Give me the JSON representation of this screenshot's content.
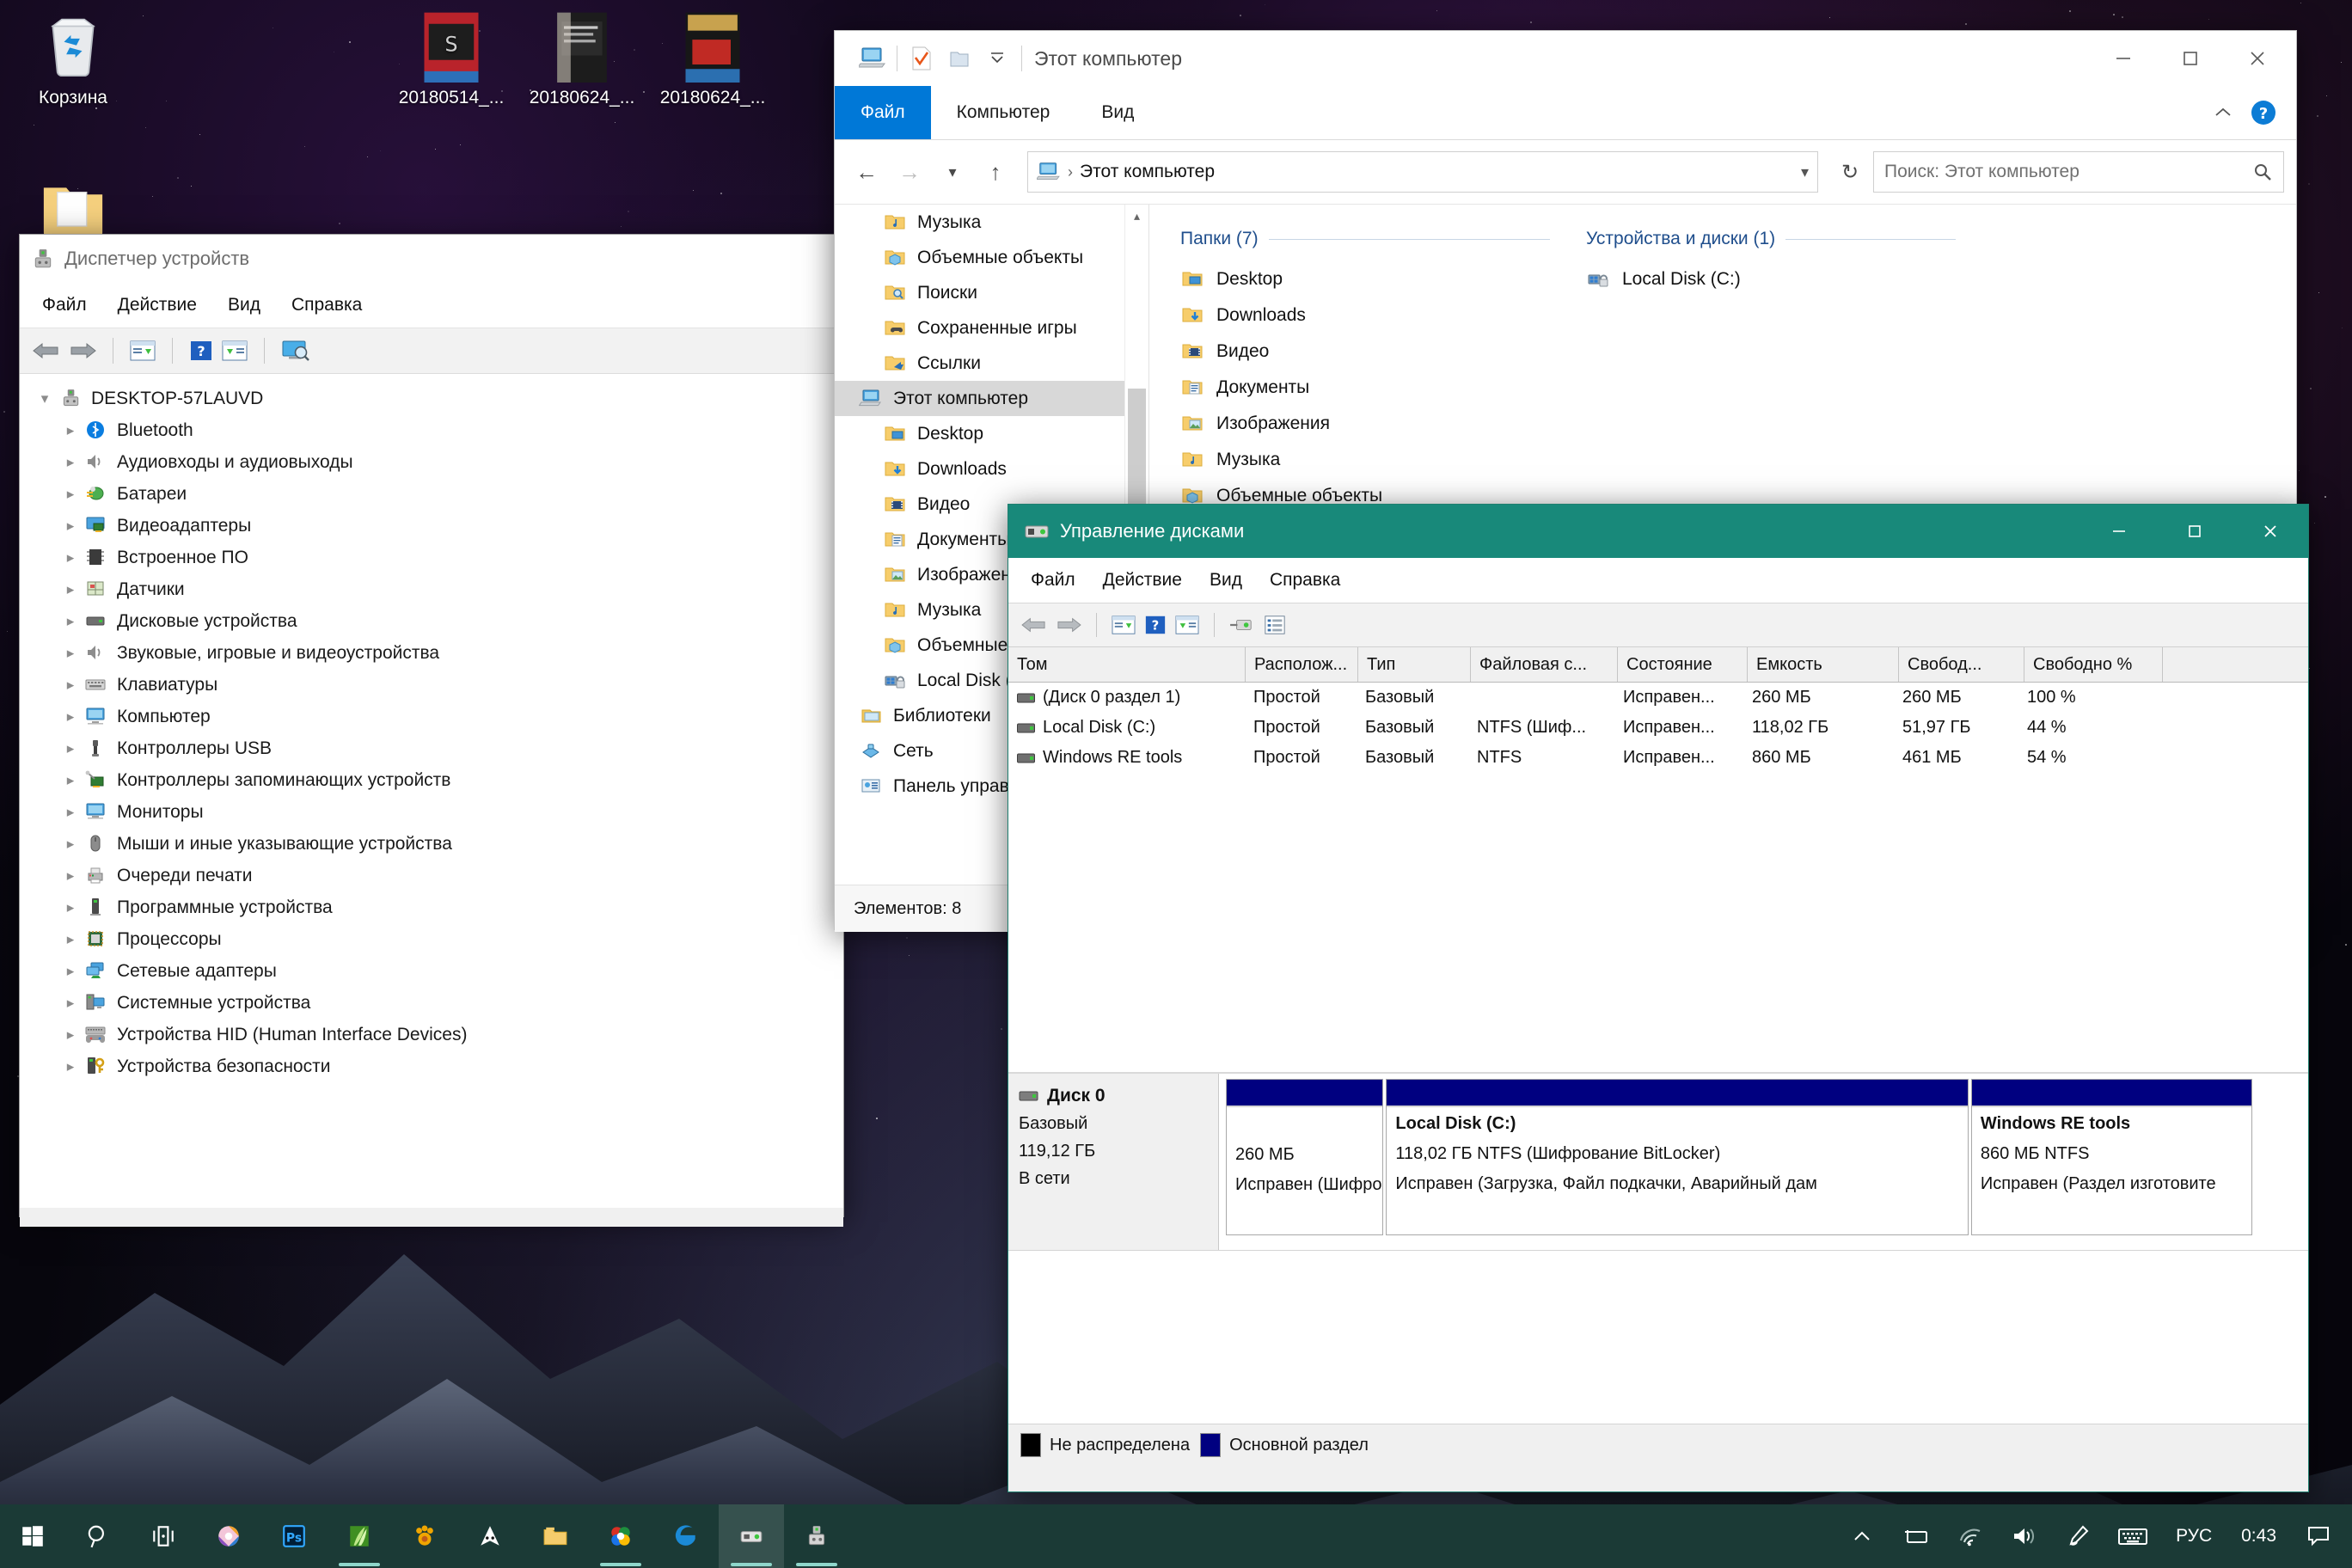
{
  "desktop": {
    "icons": [
      {
        "name": "recycle-bin",
        "label": "Корзина"
      },
      {
        "name": "photo-1",
        "label": "20180514_..."
      },
      {
        "name": "photo-2",
        "label": "20180624_..."
      },
      {
        "name": "photo-3",
        "label": "20180624_..."
      }
    ]
  },
  "device_manager": {
    "title": "Диспетчер устройств",
    "menu": [
      "Файл",
      "Действие",
      "Вид",
      "Справка"
    ],
    "toolbar_icons": [
      "back-arrow-icon",
      "forward-arrow-icon",
      "properties-icon",
      "help-icon",
      "update-driver-icon",
      "scan-hardware-icon"
    ],
    "root": "DESKTOP-57LAUVD",
    "items": [
      {
        "label": "Bluetooth",
        "icon": "bluetooth-icon"
      },
      {
        "label": "Аудиовходы и аудиовыходы",
        "icon": "audio-icon"
      },
      {
        "label": "Батареи",
        "icon": "battery-icon"
      },
      {
        "label": "Видеоадаптеры",
        "icon": "display-adapter-icon"
      },
      {
        "label": "Встроенное ПО",
        "icon": "firmware-icon"
      },
      {
        "label": "Датчики",
        "icon": "sensors-icon"
      },
      {
        "label": "Дисковые устройства",
        "icon": "disk-drive-icon"
      },
      {
        "label": "Звуковые, игровые и видеоустройства",
        "icon": "sound-icon"
      },
      {
        "label": "Клавиатуры",
        "icon": "keyboard-icon"
      },
      {
        "label": "Компьютер",
        "icon": "computer-icon"
      },
      {
        "label": "Контроллеры USB",
        "icon": "usb-icon"
      },
      {
        "label": "Контроллеры запоминающих устройств",
        "icon": "storage-controller-icon"
      },
      {
        "label": "Мониторы",
        "icon": "monitor-icon"
      },
      {
        "label": "Мыши и иные указывающие устройства",
        "icon": "mouse-icon"
      },
      {
        "label": "Очереди печати",
        "icon": "printer-icon"
      },
      {
        "label": "Программные устройства",
        "icon": "software-device-icon"
      },
      {
        "label": "Процессоры",
        "icon": "cpu-icon"
      },
      {
        "label": "Сетевые адаптеры",
        "icon": "network-adapter-icon"
      },
      {
        "label": "Системные устройства",
        "icon": "system-device-icon"
      },
      {
        "label": "Устройства HID (Human Interface Devices)",
        "icon": "hid-icon"
      },
      {
        "label": "Устройства безопасности",
        "icon": "security-device-icon"
      }
    ]
  },
  "explorer": {
    "title": "Этот компьютер",
    "quick_access_icons": [
      "this-pc-icon",
      "properties-icon",
      "new-folder-icon",
      "chevron-down-icon"
    ],
    "window_buttons": [
      "minimize-icon",
      "maximize-icon",
      "close-icon"
    ],
    "tabs": [
      {
        "label": "Файл",
        "active": true
      },
      {
        "label": "Компьютер",
        "active": false
      },
      {
        "label": "Вид",
        "active": false
      }
    ],
    "ribbon_right": [
      "chevron-up-icon",
      "help-circle-icon"
    ],
    "nav": {
      "back": "back-icon",
      "forward": "forward-icon",
      "recent": "recent-chevron-icon",
      "up": "up-icon",
      "breadcrumb_icon": "this-pc-icon",
      "breadcrumb": "Этот компьютер",
      "address_chevron": "chevron-down-icon",
      "refresh": "refresh-icon"
    },
    "search": {
      "placeholder": "Поиск: Этот компьютер",
      "icon": "search-icon"
    },
    "sidebar": [
      {
        "label": "Музыка",
        "icon": "music-folder-icon",
        "indent": 1,
        "selected": false
      },
      {
        "label": "Объемные объекты",
        "icon": "3d-objects-folder-icon",
        "indent": 1,
        "selected": false
      },
      {
        "label": "Поиски",
        "icon": "searches-folder-icon",
        "indent": 1,
        "selected": false
      },
      {
        "label": "Сохраненные игры",
        "icon": "saved-games-folder-icon",
        "indent": 1,
        "selected": false
      },
      {
        "label": "Ссылки",
        "icon": "links-folder-icon",
        "indent": 1,
        "selected": false
      },
      {
        "label": "Этот компьютер",
        "icon": "this-pc-icon",
        "indent": 0,
        "selected": true
      },
      {
        "label": "Desktop",
        "icon": "desktop-folder-icon",
        "indent": 1,
        "selected": false
      },
      {
        "label": "Downloads",
        "icon": "downloads-folder-icon",
        "indent": 1,
        "selected": false
      },
      {
        "label": "Видео",
        "icon": "videos-folder-icon",
        "indent": 1,
        "selected": false
      },
      {
        "label": "Документы",
        "icon": "documents-folder-icon",
        "indent": 1,
        "selected": false
      },
      {
        "label": "Изображения",
        "icon": "pictures-folder-icon",
        "indent": 1,
        "selected": false
      },
      {
        "label": "Музыка",
        "icon": "music-folder-icon",
        "indent": 1,
        "selected": false
      },
      {
        "label": "Объемные объекты",
        "icon": "3d-objects-folder-icon",
        "indent": 1,
        "selected": false
      },
      {
        "label": "Local Disk (C:)",
        "icon": "bitlocker-drive-icon",
        "indent": 1,
        "selected": false
      },
      {
        "label": "Библиотеки",
        "icon": "libraries-icon",
        "indent": 0,
        "selected": false
      },
      {
        "label": "Сеть",
        "icon": "network-icon",
        "indent": 0,
        "selected": false
      },
      {
        "label": "Панель управления",
        "icon": "control-panel-icon",
        "indent": 0,
        "selected": false
      }
    ],
    "groups": [
      {
        "title": "Папки (7)",
        "items": [
          {
            "label": "Desktop",
            "icon": "desktop-folder-icon"
          },
          {
            "label": "Downloads",
            "icon": "downloads-folder-icon"
          },
          {
            "label": "Видео",
            "icon": "videos-folder-icon"
          },
          {
            "label": "Документы",
            "icon": "documents-folder-icon"
          },
          {
            "label": "Изображения",
            "icon": "pictures-folder-icon"
          },
          {
            "label": "Музыка",
            "icon": "music-folder-icon"
          },
          {
            "label": "Объемные объекты",
            "icon": "3d-objects-folder-icon"
          }
        ]
      },
      {
        "title": "Устройства и диски (1)",
        "items": [
          {
            "label": "Local Disk (C:)",
            "icon": "bitlocker-drive-icon"
          }
        ]
      }
    ],
    "status": "Элементов: 8"
  },
  "disk_management": {
    "title": "Управление дисками",
    "window_buttons": [
      "minimize-icon",
      "maximize-icon",
      "close-icon"
    ],
    "menu": [
      "Файл",
      "Действие",
      "Вид",
      "Справка"
    ],
    "toolbar_icons": [
      "back-arrow-icon",
      "forward-arrow-icon",
      "properties-icon",
      "help-icon",
      "show-pane-icon",
      "rescan-disks-icon",
      "list-view-icon"
    ],
    "columns": [
      "Том",
      "Располож...",
      "Тип",
      "Файловая с...",
      "Состояние",
      "Емкость",
      "Свобод...",
      "Свободно %"
    ],
    "rows": [
      {
        "volume": "(Диск 0 раздел 1)",
        "layout": "Простой",
        "type": "Базовый",
        "fs": "",
        "status": "Исправен...",
        "capacity": "260 МБ",
        "free": "260 МБ",
        "pct": "100 %"
      },
      {
        "volume": "Local Disk (C:)",
        "layout": "Простой",
        "type": "Базовый",
        "fs": "NTFS (Шиф...",
        "status": "Исправен...",
        "capacity": "118,02 ГБ",
        "free": "51,97 ГБ",
        "pct": "44 %"
      },
      {
        "volume": "Windows RE tools",
        "layout": "Простой",
        "type": "Базовый",
        "fs": "NTFS",
        "status": "Исправен...",
        "capacity": "860 МБ",
        "free": "461 МБ",
        "pct": "54 %"
      }
    ],
    "disk": {
      "name": "Диск 0",
      "type": "Базовый",
      "size": "119,12 ГБ",
      "state": "В сети",
      "icon": "disk-icon"
    },
    "partitions": [
      {
        "name": "",
        "size": "260 МБ",
        "status": "Исправен (Шифрованны",
        "width": "14.5%"
      },
      {
        "name": "Local Disk  (C:)",
        "size": "118,02 ГБ NTFS (Шифрование BitLocker)",
        "status": "Исправен (Загрузка, Файл подкачки, Аварийный дам",
        "width": "54%"
      },
      {
        "name": "Windows RE tools",
        "size": "860 МБ NTFS",
        "status": "Исправен (Раздел изготовите",
        "width": "26%"
      }
    ],
    "legend": [
      {
        "label": "Не распределена",
        "color": "#000000"
      },
      {
        "label": "Основной раздел",
        "color": "#000080"
      }
    ]
  },
  "taskbar": {
    "items": [
      {
        "name": "start-button",
        "icon": "windows-logo-icon",
        "running": false,
        "active": false
      },
      {
        "name": "search-button",
        "icon": "search-icon",
        "running": false,
        "active": false
      },
      {
        "name": "task-view-button",
        "icon": "task-view-icon",
        "running": false,
        "active": false
      },
      {
        "name": "taskbar-app-krita",
        "icon": "color-wheel-icon",
        "running": false,
        "active": false
      },
      {
        "name": "taskbar-app-photoshop",
        "icon": "photoshop-icon",
        "running": false,
        "active": false
      },
      {
        "name": "taskbar-app-nvidia",
        "icon": "leaf-icon",
        "running": true,
        "active": false
      },
      {
        "name": "taskbar-app-gimp",
        "icon": "paw-icon",
        "running": false,
        "active": false
      },
      {
        "name": "taskbar-app-foobar",
        "icon": "fox-icon",
        "running": false,
        "active": false
      },
      {
        "name": "taskbar-app-explorer",
        "icon": "folder-icon",
        "running": false,
        "active": false
      },
      {
        "name": "taskbar-app-chrome",
        "icon": "colorful-icon",
        "running": true,
        "active": false
      },
      {
        "name": "taskbar-app-edge",
        "icon": "edge-icon",
        "running": false,
        "active": false
      },
      {
        "name": "taskbar-app-diskmgmt",
        "icon": "disk-icon",
        "running": true,
        "active": true
      },
      {
        "name": "taskbar-app-devmgmt",
        "icon": "device-icon",
        "running": true,
        "active": false
      }
    ],
    "tray": [
      {
        "name": "show-hidden-icons",
        "icon": "chevron-up-icon"
      },
      {
        "name": "battery-icon",
        "icon": "battery-charging-icon"
      },
      {
        "name": "network-icon",
        "icon": "wifi-icon"
      },
      {
        "name": "volume-icon",
        "icon": "speaker-icon"
      },
      {
        "name": "pen-icon",
        "icon": "pen-icon"
      },
      {
        "name": "keyboard-icon",
        "icon": "touch-keyboard-icon"
      }
    ],
    "language": "РУС",
    "clock": "0:43",
    "action_center_icon": "notification-icon"
  },
  "colors": {
    "explorer_accent": "#0078d7",
    "diskmgmt_title": "#18897a",
    "taskbar": "#1b3a36",
    "partition_blue": "#000080",
    "group_heading": "#1f4e8c"
  }
}
